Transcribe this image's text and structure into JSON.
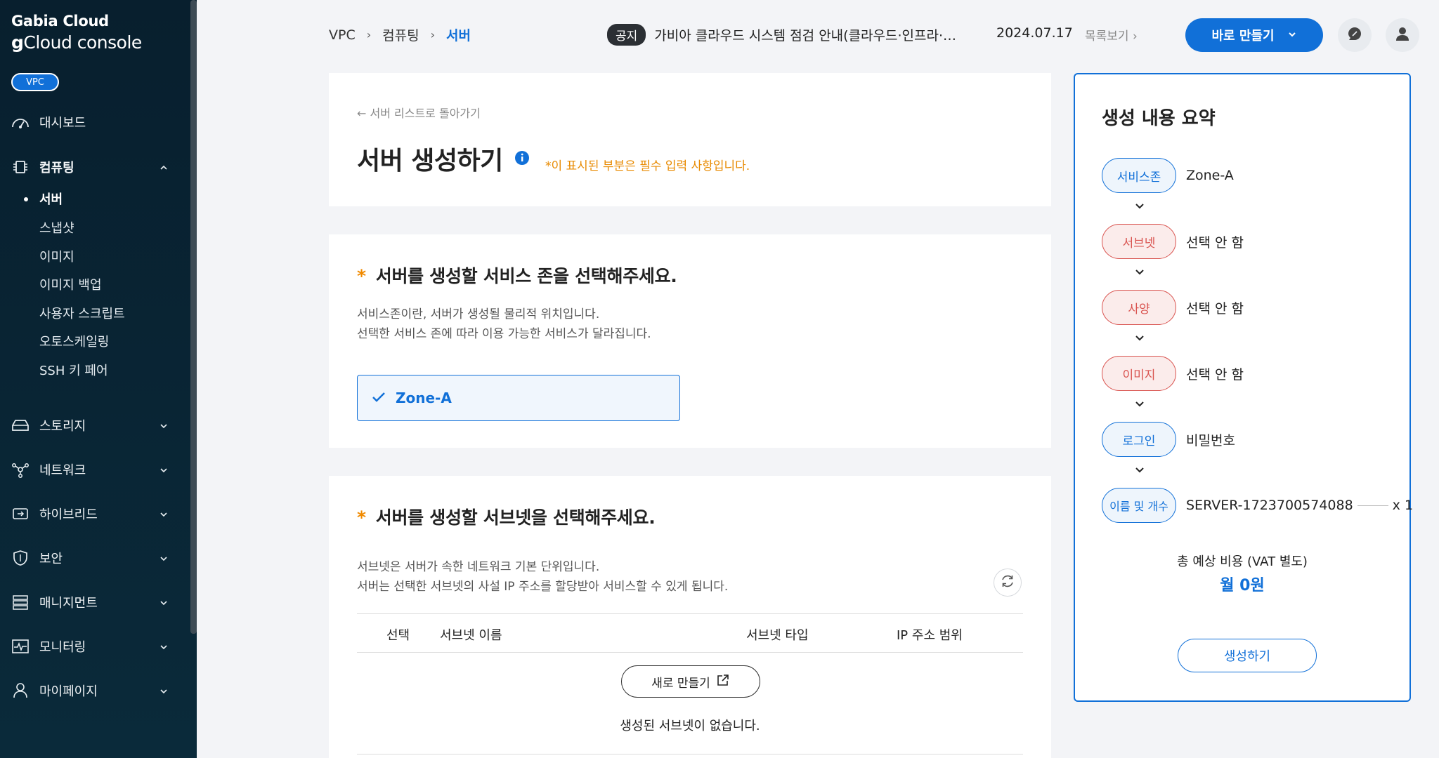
{
  "brand": {
    "line1": "Gabia Cloud",
    "line2_bold": "g",
    "line2_rest": "Cloud console"
  },
  "vpc_badge": "VPC",
  "sidebar": {
    "dashboard": "대시보드",
    "computing": "컴퓨팅",
    "computing_sub": [
      "서버",
      "스냅샷",
      "이미지",
      "이미지 백업",
      "사용자 스크립트",
      "오토스케일링",
      "SSH 키 페어"
    ],
    "storage": "스토리지",
    "network": "네트워크",
    "hybrid": "하이브리드",
    "security": "보안",
    "management": "매니지먼트",
    "monitoring": "모니터링",
    "mypage": "마이페이지"
  },
  "breadcrumb": [
    "VPC",
    "컴퓨팅",
    "서버"
  ],
  "notice": {
    "tag": "공지",
    "text": "가비아 클라우드 시스템 점검 안내(클라우드·인프라·…",
    "date": "2024.07.17",
    "more": "목록보기"
  },
  "header": {
    "quick_create": "바로 만들기"
  },
  "page": {
    "back": "서버 리스트로 돌아가기",
    "title": "서버 생성하기",
    "required_note": "*이 표시된 부분은 필수 입력 사항입니다."
  },
  "zone_section": {
    "star": "*",
    "title": "서버를 생성할 서비스 존을 선택해주세요.",
    "desc1": "서비스존이란, 서버가 생성될 물리적 위치입니다.",
    "desc2": "선택한 서비스 존에 따라 이용 가능한 서비스가 달라집니다.",
    "zone": "Zone-A"
  },
  "subnet_section": {
    "star": "*",
    "title": "서버를 생성할 서브넷을 선택해주세요.",
    "desc1": "서브넷은 서버가 속한 네트워크 기본 단위입니다.",
    "desc2": "서버는 선택한 서브넷의 사설 IP 주소를 할당받아 서비스할 수 있게 됩니다.",
    "columns": [
      "선택",
      "서브넷 이름",
      "서브넷 타입",
      "IP 주소 범위"
    ],
    "new_button": "새로 만들기",
    "empty": "생성된 서브넷이 없습니다."
  },
  "summary": {
    "title": "생성 내용 요약",
    "steps": [
      {
        "label": "서비스존",
        "value": "Zone-A",
        "status": "blue"
      },
      {
        "label": "서브넷",
        "value": "선택 안 함",
        "status": "red"
      },
      {
        "label": "사양",
        "value": "선택 안 함",
        "status": "red"
      },
      {
        "label": "이미지",
        "value": "선택 안 함",
        "status": "red"
      },
      {
        "label": "로그인",
        "value": "비밀번호",
        "status": "blue"
      },
      {
        "label": "이름 및 개수",
        "value": "SERVER-1723700574088",
        "count": "x 1",
        "status": "blue"
      }
    ],
    "cost_label": "총 예상 비용 (VAT 별도)",
    "cost_value": "월 0원",
    "create_button": "생성하기"
  },
  "colors": {
    "accent": "#1170d8",
    "warning": "#e88a00",
    "error": "#d9534f",
    "sidebar_bg": "#081f2e"
  }
}
